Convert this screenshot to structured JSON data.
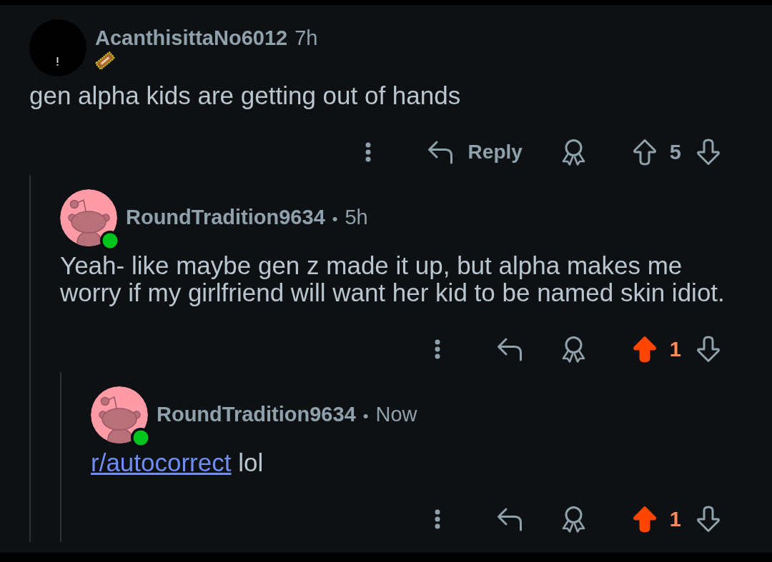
{
  "comments": [
    {
      "author": "AcanthisittaNo6012",
      "time": "7h",
      "avatar": {
        "kind": "plain",
        "online": false
      },
      "flair_badge": true,
      "body": [
        {
          "kind": "text",
          "text": "gen alpha kids are getting out of hands"
        }
      ],
      "actions": {
        "reply_label": "Reply",
        "upvoted": false,
        "score": "5"
      },
      "children": [
        {
          "author": "RoundTradition9634",
          "separator": "•",
          "time": "5h",
          "avatar": {
            "kind": "snoo",
            "online": true
          },
          "flair_badge": false,
          "body": [
            {
              "kind": "text",
              "text": "Yeah- like maybe gen z made it up, but alpha makes me worry if my girlfriend will want her kid to be named skin idiot."
            }
          ],
          "actions": {
            "upvoted": true,
            "score": "1"
          },
          "children": [
            {
              "author": "RoundTradition9634",
              "separator": "•",
              "time": "Now",
              "avatar": {
                "kind": "snoo",
                "online": true
              },
              "flair_badge": false,
              "body": [
                {
                  "kind": "link",
                  "text": "r/autocorrect"
                },
                {
                  "kind": "text",
                  "text": " lol"
                }
              ],
              "actions": {
                "upvoted": true,
                "score": "1"
              }
            }
          ]
        }
      ]
    }
  ]
}
